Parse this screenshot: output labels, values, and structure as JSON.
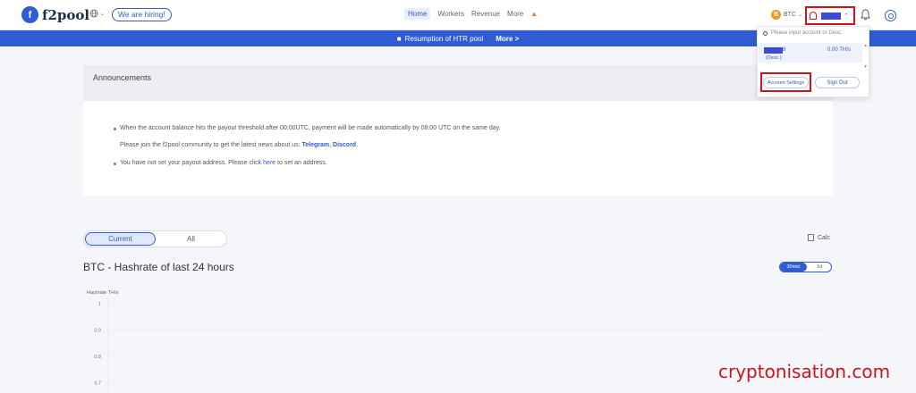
{
  "header": {
    "logo_text": "f2pool",
    "hiring_label": "We are hiring!",
    "nav": [
      {
        "label": "Home"
      },
      {
        "label": "Workers"
      },
      {
        "label": "Revenue"
      },
      {
        "label": "More"
      }
    ],
    "coin_label": "BTC",
    "icons": [
      "globe-icon",
      "bell-icon",
      "search-icon"
    ]
  },
  "banner": {
    "text": "Resumption of HTR pool",
    "more_label": "More >"
  },
  "announcements": {
    "title": "Announcements",
    "line1": "When the account balance hits the payout threshold after 00:00UTC, payment will be made automatically by 08:00 UTC on the same day.",
    "line2_prefix": "Please join the f2pool community to get the latest news about us: ",
    "telegram": "Telegram",
    "comma": ", ",
    "discord": "Discord",
    "period": ".",
    "line3_prefix": "You have not set your payout address. Please click ",
    "here": "here",
    "line3_suffix": " to set an address."
  },
  "toggle": {
    "current_label": "Current",
    "all_label": "All",
    "selected": "Current"
  },
  "calc_label": "Calc",
  "hashrate": {
    "title": "BTC - Hashrate of last 24 hours",
    "range_options": [
      "30min",
      "1d"
    ],
    "selected_range": "30min"
  },
  "dropdown": {
    "search_placeholder": "Please input account or Desc.",
    "account_suffix": "8",
    "account_desc": "(Desc.)",
    "account_hashrate": "0.00 TH/s",
    "account_settings_label": "Account Settings",
    "sign_out_label": "Sign Out"
  },
  "chart_data": {
    "type": "line",
    "ylabel": "Hashrate TH/s",
    "yticks": [
      "1",
      "0.9",
      "0.8",
      "0.7"
    ],
    "series": []
  },
  "watermark": "cryptonisation.com",
  "colors": {
    "accent": "#2f5bd3",
    "highlight_red": "#d0121b",
    "btc_orange": "#f29a20"
  }
}
